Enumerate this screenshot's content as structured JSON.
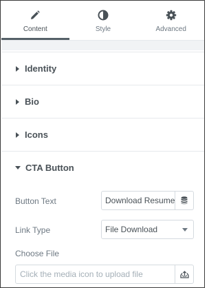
{
  "tabs": [
    {
      "label": "Content",
      "icon": "pencil-icon",
      "active": true
    },
    {
      "label": "Style",
      "icon": "half-circle-icon",
      "active": false
    },
    {
      "label": "Advanced",
      "icon": "gear-icon",
      "active": false
    }
  ],
  "sections": [
    {
      "title": "Identity",
      "expanded": false
    },
    {
      "title": "Bio",
      "expanded": false
    },
    {
      "title": "Icons",
      "expanded": false
    },
    {
      "title": "CTA Button",
      "expanded": true
    }
  ],
  "cta": {
    "button_text_label": "Button Text",
    "button_text_value": "Download Resume",
    "link_type_label": "Link Type",
    "link_type_value": "File Download",
    "choose_file_label": "Choose File",
    "choose_file_placeholder": "Click the media icon to upload file"
  },
  "colors": {
    "accent": "#556068",
    "border": "#d5dadf",
    "text": "#495157"
  }
}
